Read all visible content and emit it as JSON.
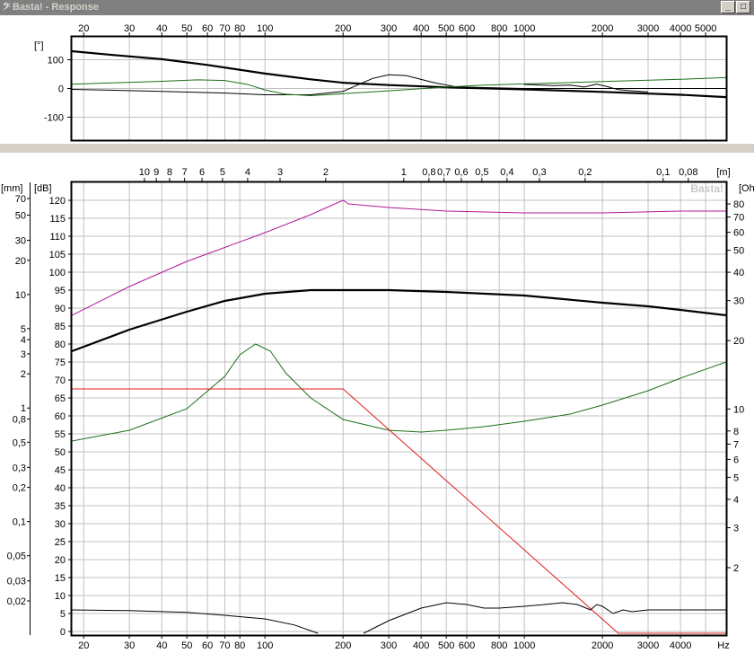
{
  "window": {
    "title": "Basta! - Response",
    "icon": "basta-clef-icon",
    "minimize_glyph": "_",
    "maximize_glyph": "□"
  },
  "watermark": "Basta!",
  "colors": {
    "spl": "#000000",
    "power": "#b0189a",
    "impedance": "#1c6e1c",
    "excursion": "#e01b1b",
    "phase": "#000000",
    "group_delay": "#000000",
    "grid": "#c0c0c0",
    "frame": "#000000"
  },
  "x_axis": {
    "scale": "log",
    "range": [
      18,
      6000
    ],
    "unit": "Hz",
    "ticks": [
      {
        "v": 20,
        "label": "20"
      },
      {
        "v": 30,
        "label": "30"
      },
      {
        "v": 40,
        "label": "40"
      },
      {
        "v": 50,
        "label": "50"
      },
      {
        "v": 60,
        "label": "60"
      },
      {
        "v": 70,
        "label": "70"
      },
      {
        "v": 80,
        "label": "80"
      },
      {
        "v": 100,
        "label": "100"
      },
      {
        "v": 200,
        "label": "200"
      },
      {
        "v": 300,
        "label": "300"
      },
      {
        "v": 400,
        "label": "400"
      },
      {
        "v": 500,
        "label": "500"
      },
      {
        "v": 600,
        "label": "600"
      },
      {
        "v": 800,
        "label": "800"
      },
      {
        "v": 1000,
        "label": "1000"
      },
      {
        "v": 2000,
        "label": "2000"
      },
      {
        "v": 3000,
        "label": "3000"
      },
      {
        "v": 4000,
        "label": "4000"
      },
      {
        "v": 5000,
        "label": "5000"
      }
    ],
    "bottom_ticks": [
      {
        "v": 20,
        "label": "20"
      },
      {
        "v": 30,
        "label": "30"
      },
      {
        "v": 40,
        "label": "40"
      },
      {
        "v": 50,
        "label": "50"
      },
      {
        "v": 60,
        "label": "60"
      },
      {
        "v": 70,
        "label": "70"
      },
      {
        "v": 80,
        "label": "80"
      },
      {
        "v": 100,
        "label": "100"
      },
      {
        "v": 200,
        "label": "200"
      },
      {
        "v": 300,
        "label": "300"
      },
      {
        "v": 400,
        "label": "400"
      },
      {
        "v": 500,
        "label": "500"
      },
      {
        "v": 600,
        "label": "600"
      },
      {
        "v": 800,
        "label": "800"
      },
      {
        "v": 1000,
        "label": "1000"
      },
      {
        "v": 2000,
        "label": "2000"
      },
      {
        "v": 3000,
        "label": "3000"
      },
      {
        "v": 4000,
        "label": "4000"
      }
    ]
  },
  "chart_data": [
    {
      "type": "line",
      "y_unit": "[°]",
      "ylim": [
        -180,
        180
      ],
      "y_ticks": [
        {
          "v": 100,
          "label": "100"
        },
        {
          "v": 0,
          "label": "0"
        },
        {
          "v": -100,
          "label": "-100"
        }
      ],
      "grid": true,
      "series": [
        {
          "key": "phase_thick",
          "color": "#000000",
          "width": 2.2,
          "points": [
            [
              18,
              130
            ],
            [
              25,
              118
            ],
            [
              40,
              102
            ],
            [
              60,
              82
            ],
            [
              100,
              52
            ],
            [
              150,
              32
            ],
            [
              200,
              20
            ],
            [
              300,
              12
            ],
            [
              500,
              4
            ],
            [
              1000,
              -3
            ],
            [
              2000,
              -12
            ],
            [
              4000,
              -22
            ],
            [
              6000,
              -30
            ]
          ]
        },
        {
          "key": "phase_thin",
          "color": "#000000",
          "width": 1,
          "points": [
            [
              18,
              -3
            ],
            [
              40,
              -10
            ],
            [
              70,
              -16
            ],
            [
              100,
              -22
            ],
            [
              150,
              -22
            ],
            [
              200,
              -10
            ],
            [
              260,
              35
            ],
            [
              300,
              48
            ],
            [
              350,
              45
            ],
            [
              450,
              20
            ],
            [
              550,
              5
            ],
            [
              800,
              2
            ],
            [
              1000,
              0
            ],
            [
              2000,
              0
            ],
            [
              4000,
              0
            ],
            [
              6000,
              0
            ]
          ]
        },
        {
          "key": "phase_green",
          "color": "#1c6e1c",
          "width": 1,
          "points": [
            [
              18,
              15
            ],
            [
              40,
              25
            ],
            [
              55,
              30
            ],
            [
              70,
              28
            ],
            [
              85,
              15
            ],
            [
              100,
              -5
            ],
            [
              120,
              -20
            ],
            [
              150,
              -25
            ],
            [
              200,
              -18
            ],
            [
              300,
              -8
            ],
            [
              500,
              5
            ],
            [
              700,
              12
            ],
            [
              1000,
              16
            ],
            [
              2000,
              24
            ],
            [
              4000,
              32
            ],
            [
              6000,
              38
            ]
          ]
        },
        {
          "key": "phase_detail",
          "color": "#000000",
          "width": 1,
          "points": [
            [
              1000,
              14
            ],
            [
              1300,
              10
            ],
            [
              1500,
              12
            ],
            [
              1700,
              5
            ],
            [
              1900,
              15
            ],
            [
              2100,
              6
            ],
            [
              2300,
              -4
            ],
            [
              2600,
              -8
            ],
            [
              3000,
              -12
            ]
          ]
        }
      ]
    },
    {
      "type": "line",
      "y_unit": "[dB]",
      "ylim": [
        -1,
        125
      ],
      "y_ticks": [
        {
          "v": 120,
          "label": "120"
        },
        {
          "v": 115,
          "label": "115"
        },
        {
          "v": 110,
          "label": "110"
        },
        {
          "v": 105,
          "label": "105"
        },
        {
          "v": 100,
          "label": "100"
        },
        {
          "v": 95,
          "label": "95"
        },
        {
          "v": 90,
          "label": "90"
        },
        {
          "v": 85,
          "label": "85"
        },
        {
          "v": 80,
          "label": "80"
        },
        {
          "v": 75,
          "label": "75"
        },
        {
          "v": 70,
          "label": "70"
        },
        {
          "v": 65,
          "label": "65"
        },
        {
          "v": 60,
          "label": "60"
        },
        {
          "v": 55,
          "label": "55"
        },
        {
          "v": 50,
          "label": "50"
        },
        {
          "v": 45,
          "label": "45"
        },
        {
          "v": 40,
          "label": "40"
        },
        {
          "v": 35,
          "label": "35"
        },
        {
          "v": 30,
          "label": "30"
        },
        {
          "v": 25,
          "label": "25"
        },
        {
          "v": 20,
          "label": "20"
        },
        {
          "v": 15,
          "label": "15"
        },
        {
          "v": 10,
          "label": "10"
        },
        {
          "v": 5,
          "label": "5"
        },
        {
          "v": 0,
          "label": "0"
        }
      ],
      "excursion_axis": {
        "unit": "[mm]",
        "ticks": [
          {
            "v": 70,
            "label": "70"
          },
          {
            "v": 50,
            "label": "50"
          },
          {
            "v": 30,
            "label": "30"
          },
          {
            "v": 20,
            "label": "20"
          },
          {
            "v": 10,
            "label": "10"
          },
          {
            "v": 5,
            "label": "5"
          },
          {
            "v": 4,
            "label": "4"
          },
          {
            "v": 3,
            "label": "3"
          },
          {
            "v": 2,
            "label": "2"
          },
          {
            "v": 1,
            "label": "1"
          },
          {
            "v": 0.8,
            "label": "0,8"
          },
          {
            "v": 0.5,
            "label": "0,5"
          },
          {
            "v": 0.3,
            "label": "0,3"
          },
          {
            "v": 0.2,
            "label": "0,2"
          },
          {
            "v": 0.1,
            "label": "0,1"
          },
          {
            "v": 0.05,
            "label": "0,05"
          },
          {
            "v": 0.03,
            "label": "0,03"
          },
          {
            "v": 0.02,
            "label": "0,02"
          }
        ]
      },
      "impedance_axis": {
        "unit": "[Oh",
        "ticks": [
          {
            "v": 80,
            "label": "80"
          },
          {
            "v": 70,
            "label": "70"
          },
          {
            "v": 60,
            "label": "60"
          },
          {
            "v": 50,
            "label": "50"
          },
          {
            "v": 40,
            "label": "40"
          },
          {
            "v": 30,
            "label": "30"
          },
          {
            "v": 20,
            "label": "20"
          },
          {
            "v": 10,
            "label": "10"
          },
          {
            "v": 8,
            "label": "8"
          },
          {
            "v": 7,
            "label": "7"
          },
          {
            "v": 6,
            "label": "6"
          },
          {
            "v": 5,
            "label": "5"
          },
          {
            "v": 4,
            "label": "4"
          },
          {
            "v": 3,
            "label": "3"
          },
          {
            "v": 2,
            "label": "2"
          }
        ]
      },
      "wavelength_axis": {
        "unit": "[m]",
        "ticks": [
          {
            "v": 10,
            "label": "10"
          },
          {
            "v": 9,
            "label": "9"
          },
          {
            "v": 8,
            "label": "8"
          },
          {
            "v": 7,
            "label": "7"
          },
          {
            "v": 6,
            "label": "6"
          },
          {
            "v": 5,
            "label": "5"
          },
          {
            "v": 4,
            "label": "4"
          },
          {
            "v": 3,
            "label": "3"
          },
          {
            "v": 2,
            "label": "2"
          },
          {
            "v": 1,
            "label": "1"
          },
          {
            "v": 0.8,
            "label": "0,8"
          },
          {
            "v": 0.7,
            "label": "0,7"
          },
          {
            "v": 0.6,
            "label": "0,6"
          },
          {
            "v": 0.5,
            "label": "0,5"
          },
          {
            "v": 0.4,
            "label": "0,4"
          },
          {
            "v": 0.3,
            "label": "0,3"
          },
          {
            "v": 0.2,
            "label": "0,2"
          },
          {
            "v": 0.1,
            "label": "0,1"
          },
          {
            "v": 0.08,
            "label": "0,08"
          }
        ]
      },
      "grid": true,
      "series": [
        {
          "key": "power",
          "color": "#b0189a",
          "width": 1,
          "points": [
            [
              18,
              88
            ],
            [
              30,
              96
            ],
            [
              50,
              103
            ],
            [
              100,
              111
            ],
            [
              150,
              116
            ],
            [
              200,
              120
            ],
            [
              210,
              119
            ],
            [
              300,
              118
            ],
            [
              500,
              117
            ],
            [
              1000,
              116.5
            ],
            [
              2000,
              116.5
            ],
            [
              4000,
              117
            ],
            [
              6000,
              117
            ]
          ]
        },
        {
          "key": "spl",
          "color": "#000000",
          "width": 2.2,
          "points": [
            [
              18,
              78
            ],
            [
              30,
              84
            ],
            [
              50,
              89
            ],
            [
              70,
              92
            ],
            [
              100,
              94
            ],
            [
              150,
              95
            ],
            [
              200,
              95
            ],
            [
              300,
              95
            ],
            [
              500,
              94.5
            ],
            [
              1000,
              93.5
            ],
            [
              2000,
              91.5
            ],
            [
              3000,
              90.5
            ],
            [
              4000,
              89.5
            ],
            [
              6000,
              88
            ]
          ]
        },
        {
          "key": "impedance",
          "color": "#1c6e1c",
          "width": 1,
          "points": [
            [
              18,
              53
            ],
            [
              30,
              56
            ],
            [
              50,
              62
            ],
            [
              70,
              71
            ],
            [
              80,
              77
            ],
            [
              92,
              80
            ],
            [
              105,
              78
            ],
            [
              120,
              72
            ],
            [
              150,
              65
            ],
            [
              200,
              59
            ],
            [
              300,
              56
            ],
            [
              400,
              55.5
            ],
            [
              500,
              56
            ],
            [
              700,
              57
            ],
            [
              1000,
              58.5
            ],
            [
              1500,
              60.5
            ],
            [
              2000,
              63
            ],
            [
              3000,
              67
            ],
            [
              4000,
              70.5
            ],
            [
              6000,
              75
            ]
          ]
        },
        {
          "key": "excursion",
          "color": "#e01b1b",
          "width": 1,
          "points": [
            [
              18,
              67.5
            ],
            [
              200,
              67.5
            ],
            [
              2300,
              -0.5
            ],
            [
              6000,
              -0.5
            ]
          ]
        },
        {
          "key": "group_delay_a",
          "color": "#000000",
          "width": 1,
          "points": [
            [
              18,
              6
            ],
            [
              30,
              5.8
            ],
            [
              50,
              5.3
            ],
            [
              70,
              4.5
            ],
            [
              100,
              3.5
            ],
            [
              130,
              1.8
            ],
            [
              160,
              -0.5
            ]
          ]
        },
        {
          "key": "group_delay_b",
          "color": "#000000",
          "width": 1,
          "points": [
            [
              240,
              -0.5
            ],
            [
              300,
              3
            ],
            [
              400,
              6.5
            ],
            [
              500,
              8
            ],
            [
              600,
              7.5
            ],
            [
              700,
              6.5
            ],
            [
              800,
              6.5
            ],
            [
              1000,
              7
            ],
            [
              1200,
              7.5
            ],
            [
              1400,
              8
            ],
            [
              1600,
              7.5
            ],
            [
              1800,
              6
            ],
            [
              1900,
              7.5
            ],
            [
              2000,
              7
            ],
            [
              2200,
              5
            ],
            [
              2400,
              6
            ],
            [
              2600,
              5.5
            ],
            [
              3000,
              6
            ],
            [
              4000,
              6
            ],
            [
              6000,
              6
            ]
          ]
        }
      ]
    }
  ]
}
